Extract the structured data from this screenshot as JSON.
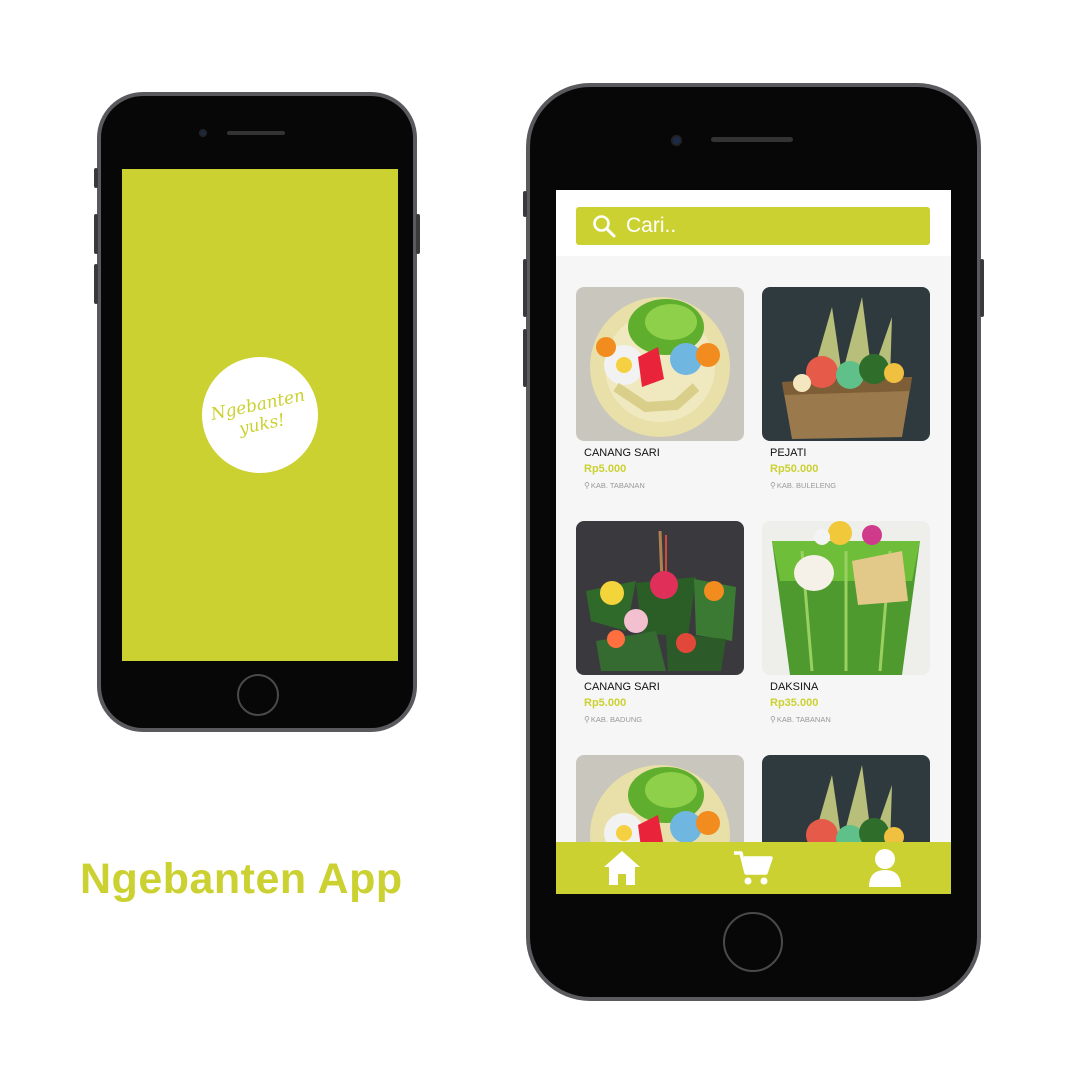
{
  "splash": {
    "logo_line1": "Ngebanten",
    "logo_line2": "yuks!"
  },
  "search": {
    "placeholder": "Cari.."
  },
  "products": [
    {
      "name": "CANANG SARI",
      "price": "Rp5.000",
      "location": "KAB. TABANAN",
      "image": "canang-sari-offering-photo"
    },
    {
      "name": "PEJATI",
      "price": "Rp50.000",
      "location": "KAB. BULELENG",
      "image": "pejati-basket-offering-photo"
    },
    {
      "name": "CANANG SARI",
      "price": "Rp5.000",
      "location": "KAB. BADUNG",
      "image": "canang-offerings-with-incense-photo"
    },
    {
      "name": "DAKSINA",
      "price": "Rp35.000",
      "location": "KAB. TABANAN",
      "image": "daksina-leaf-container-photo"
    },
    {
      "image": "canang-sari-offering-photo"
    },
    {
      "image": "pejati-basket-offering-photo"
    }
  ],
  "nav": {
    "items": [
      "home-icon",
      "cart-icon",
      "user-icon"
    ]
  },
  "app_title": "Ngebanten App",
  "colors": {
    "accent": "#cbd131",
    "phone_frame": "#5a5a5e",
    "bezel": "#070707"
  }
}
